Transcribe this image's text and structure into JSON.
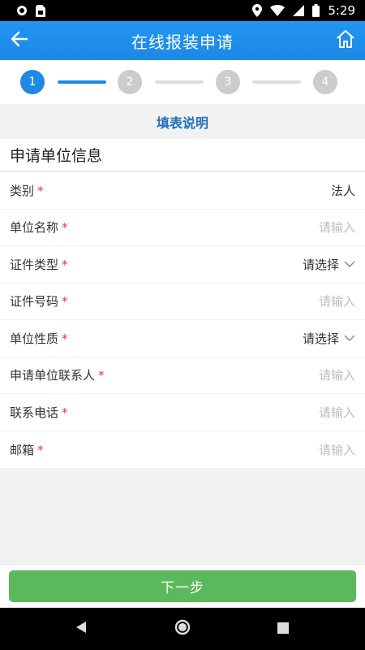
{
  "status_bar": {
    "time": "5:29",
    "icons": [
      "circle-icon",
      "sim-card-icon",
      "location-icon",
      "wifi-icon",
      "signal-icon",
      "battery-icon"
    ]
  },
  "header": {
    "title": "在线报装申请",
    "back_icon": "arrow-left-icon",
    "home_icon": "home-icon"
  },
  "stepper": {
    "steps": [
      "1",
      "2",
      "3",
      "4"
    ],
    "current": 1
  },
  "instructions_label": "填表说明",
  "section_title": "申请单位信息",
  "form": {
    "fields": [
      {
        "label": "类别",
        "required": "*",
        "value": "法人",
        "kind": "value"
      },
      {
        "label": "单位名称",
        "required": "*",
        "value": "请输入",
        "kind": "input"
      },
      {
        "label": "证件类型",
        "required": "*",
        "value": "请选择",
        "kind": "select"
      },
      {
        "label": "证件号码",
        "required": "*",
        "value": "请输入",
        "kind": "input"
      },
      {
        "label": "单位性质",
        "required": "*",
        "value": "请选择",
        "kind": "select"
      },
      {
        "label": "申请单位联系人",
        "required": "*",
        "value": "请输入",
        "kind": "input"
      },
      {
        "label": "联系电话",
        "required": "*",
        "value": "请输入",
        "kind": "input"
      },
      {
        "label": "邮箱",
        "required": "*",
        "value": "请输入",
        "kind": "input"
      }
    ]
  },
  "next_button_label": "下一步",
  "colors": {
    "primary": "#1E88E5",
    "accent_green": "#5CB85C",
    "required_red": "#E53935",
    "inactive_step": "#CCCCCC"
  }
}
